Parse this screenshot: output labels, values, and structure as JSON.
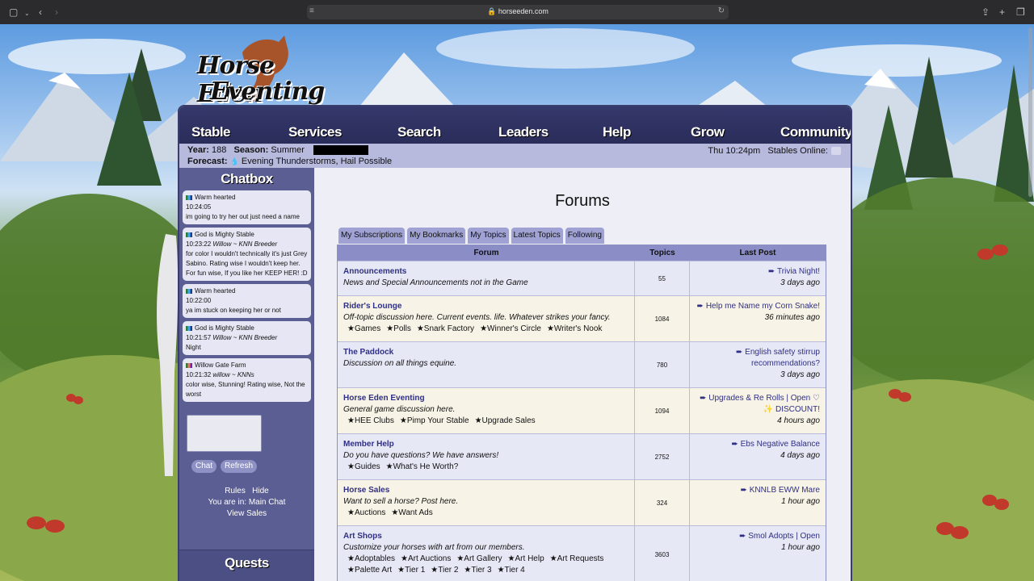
{
  "browser": {
    "url": "horseeden.com"
  },
  "logo": {
    "line1": "Horse Eden",
    "line2": "Eventing"
  },
  "nav": {
    "items": [
      "Stable",
      "Services",
      "Search",
      "Leaders",
      "Help",
      "Grow",
      "Community"
    ]
  },
  "info": {
    "year_label": "Year:",
    "year": "188",
    "season_label": "Season:",
    "season": "Summer",
    "forecast_label": "Forecast:",
    "forecast": "Evening Thunderstorms, Hail Possible",
    "time": "Thu 10:24pm",
    "stables_online_label": "Stables Online:"
  },
  "chatbox": {
    "title": "Chatbox",
    "messages": [
      {
        "name": "Warm hearted",
        "time": "10:24:05",
        "sub": "",
        "text": "im going to try her out just need a name"
      },
      {
        "name": "God is Mighty Stable",
        "time": "10:23:22",
        "sub": "Willow ~ KNN Breeder",
        "text": "for color I wouldn't technically it's just Grey Sabino. Rating wise I wouldn't keep her. For fun wise, If you like her KEEP HER! :D"
      },
      {
        "name": "Warm hearted",
        "time": "10:22:00",
        "sub": "",
        "text": "ya im stuck on keeping her or not"
      },
      {
        "name": "God is Mighty Stable",
        "time": "10:21:57",
        "sub": "Willow ~ KNN Breeder",
        "text": "Night"
      },
      {
        "name": "Willow Gate Farm",
        "time": "10:21:32",
        "sub": "willow ~ KNNs",
        "text": "color wise, Stunning! Rating wise, Not the worst"
      }
    ],
    "chat_button": "Chat",
    "refresh_button": "Refresh",
    "rules": "Rules",
    "hide": "Hide",
    "location": "You are in: Main Chat",
    "view_sales": "View Sales",
    "quests_title": "Quests"
  },
  "forum": {
    "title": "Forums",
    "tabs": [
      "My Subscriptions",
      "My Bookmarks",
      "My Topics",
      "Latest Topics",
      "Following"
    ],
    "headers": {
      "forum": "Forum",
      "topics": "Topics",
      "last_post": "Last Post"
    },
    "rows": [
      {
        "name": "Announcements",
        "desc": "News and Special Announcements not in the Game",
        "subs": [],
        "topics": "55",
        "last_title": "➨ Trivia Night!",
        "last_time": "3 days ago"
      },
      {
        "name": "Rider's Lounge",
        "desc": "Off-topic discussion here. Current events. life. Whatever strikes your fancy.",
        "subs": [
          "★Games",
          "★Polls",
          "★Snark Factory",
          "★Winner's Circle",
          "★Writer's Nook"
        ],
        "topics": "1084",
        "last_title": "➨ Help me Name my Corn Snake!",
        "last_time": "36 minutes ago"
      },
      {
        "name": "The Paddock",
        "desc": "Discussion on all things equine.",
        "subs": [],
        "topics": "780",
        "last_title": "➨ English safety stirrup recommendations?",
        "last_time": "3 days ago"
      },
      {
        "name": "Horse Eden Eventing",
        "desc": "General game discussion here.",
        "subs": [
          "★HEE Clubs",
          "★Pimp Your Stable",
          "★Upgrade Sales"
        ],
        "topics": "1094",
        "last_title": "➨ Upgrades & Re Rolls | Open ♡ ✨ DISCOUNT!",
        "last_time": "4 hours ago"
      },
      {
        "name": "Member Help",
        "desc": "Do you have questions? We have answers!",
        "subs": [
          "★Guides",
          "★What's He Worth?"
        ],
        "topics": "2752",
        "last_title": "➨ Ebs Negative Balance",
        "last_time": "4 days ago"
      },
      {
        "name": "Horse Sales",
        "desc": "Want to sell a horse? Post here.",
        "subs": [
          "★Auctions",
          "★Want Ads"
        ],
        "topics": "324",
        "last_title": "➨ KNNLB EWW Mare",
        "last_time": "1 hour ago"
      },
      {
        "name": "Art Shops",
        "desc": "Customize your horses with art from our members.",
        "subs": [
          "★Adoptables",
          "★Art Auctions",
          "★Art Gallery",
          "★Art Help",
          "★Art Requests",
          "★Palette Art",
          "★Tier 1",
          "★Tier 2",
          "★Tier 3",
          "★Tier 4"
        ],
        "topics": "3603",
        "last_title": "➨ Smol Adopts | Open",
        "last_time": "1 hour ago"
      }
    ]
  }
}
